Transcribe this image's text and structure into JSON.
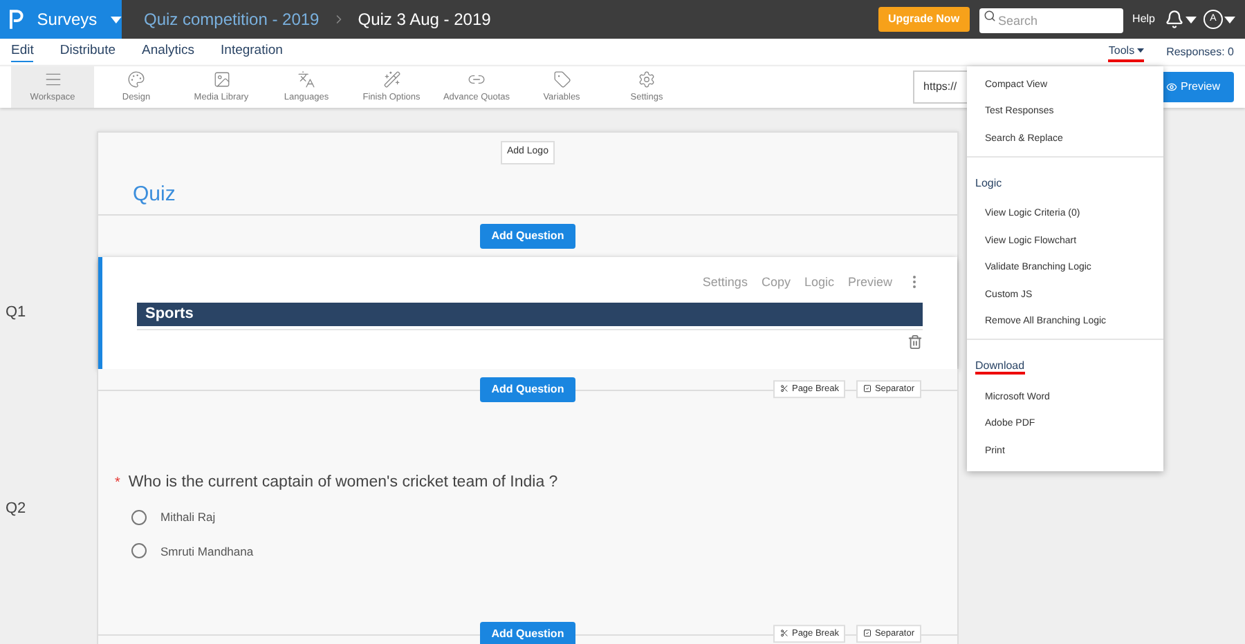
{
  "topbar": {
    "app": "Surveys",
    "breadcrumb": [
      "Quiz competition - 2019",
      "Quiz 3 Aug - 2019"
    ],
    "upgrade": "Upgrade Now",
    "search": {
      "placeholder": "Search"
    },
    "help": "Help",
    "avatar": "A"
  },
  "tabs": [
    {
      "label": "Edit",
      "selected": true
    },
    {
      "label": "Distribute",
      "selected": false
    },
    {
      "label": "Analytics",
      "selected": false
    },
    {
      "label": "Integration",
      "selected": false
    }
  ],
  "tools_menu": {
    "label": "Tools",
    "expanded": true
  },
  "responses": "Responses: 0",
  "toolbar": [
    {
      "label": "Workspace",
      "selected": true
    },
    {
      "label": "Design",
      "selected": false
    },
    {
      "label": "Media Library",
      "selected": false
    },
    {
      "label": "Languages",
      "selected": false
    },
    {
      "label": "Finish Options",
      "selected": false
    },
    {
      "label": "Advance Quotas",
      "selected": false
    },
    {
      "label": "Variables",
      "selected": false
    },
    {
      "label": "Settings",
      "selected": false
    }
  ],
  "url_field": {
    "value": "https://"
  },
  "preview_button": "Preview",
  "dropdown": [
    {
      "kind": "item",
      "label": "Compact View"
    },
    {
      "kind": "item",
      "label": "Test Responses"
    },
    {
      "kind": "item",
      "label": "Search & Replace"
    },
    {
      "kind": "heading",
      "label": "Logic",
      "underlined": false
    },
    {
      "kind": "item",
      "label": "View Logic Criteria (0)"
    },
    {
      "kind": "item",
      "label": "View Logic Flowchart"
    },
    {
      "kind": "item",
      "label": "Validate Branching Logic"
    },
    {
      "kind": "item",
      "label": "Custom JS"
    },
    {
      "kind": "item",
      "label": "Remove All Branching Logic"
    },
    {
      "kind": "heading",
      "label": "Download",
      "underlined": true
    },
    {
      "kind": "item",
      "label": "Microsoft Word"
    },
    {
      "kind": "item",
      "label": "Adobe PDF"
    },
    {
      "kind": "item",
      "label": "Print"
    }
  ],
  "survey": {
    "add_logo": "Add Logo",
    "title": "Quiz",
    "add_question": "Add Question",
    "questions": [
      {
        "number": "Q1",
        "kind": "section",
        "active": true,
        "actions": [
          "Settings",
          "Copy",
          "Logic",
          "Preview"
        ],
        "text": "Sports",
        "after": {
          "add_question": "Add Question",
          "page_break": "Page Break",
          "separator": "Separator"
        }
      },
      {
        "number": "Q2",
        "kind": "radio",
        "active": false,
        "required_mark": "*",
        "text": "Who is the current captain of women's cricket team of India ?",
        "options": [
          {
            "label": "Mithali Raj",
            "selected": false
          },
          {
            "label": "Smruti Mandhana",
            "selected": false
          }
        ],
        "after": {
          "add_question": "Add Question",
          "page_break": "Page Break",
          "separator": "Separator"
        }
      }
    ]
  }
}
